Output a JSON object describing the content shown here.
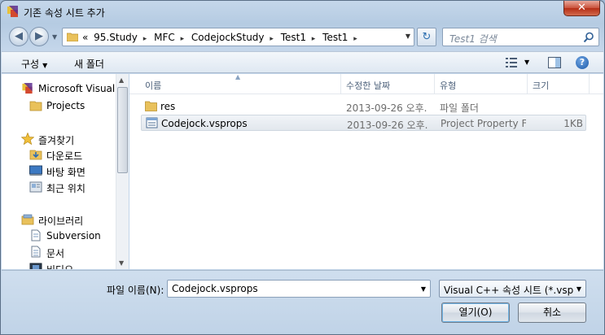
{
  "window": {
    "title": "기존 속성 시트 추가",
    "close_label": "✕"
  },
  "address": {
    "crumbs": [
      "«",
      "95.Study",
      "MFC",
      "CodejockStudy",
      "Test1",
      "Test1"
    ],
    "separator": "▸"
  },
  "search": {
    "placeholder": "Test1 검색"
  },
  "toolbar": {
    "organize_label": "구성",
    "new_folder_label": "새 폴더"
  },
  "nav": {
    "items": [
      {
        "label": "Microsoft Visual S",
        "icon": "visual-studio-icon"
      },
      {
        "label": "Projects",
        "icon": "folder-icon"
      },
      {
        "label": "즐겨찾기",
        "icon": "favorites-star-icon"
      },
      {
        "label": "다운로드",
        "icon": "downloads-icon"
      },
      {
        "label": "바탕 화면",
        "icon": "desktop-icon"
      },
      {
        "label": "최근 위치",
        "icon": "recent-places-icon"
      },
      {
        "label": "라이브러리",
        "icon": "libraries-icon"
      },
      {
        "label": "Subversion",
        "icon": "document-library-icon"
      },
      {
        "label": "문서",
        "icon": "documents-icon"
      },
      {
        "label": "비디오",
        "icon": "videos-icon"
      }
    ]
  },
  "columns": {
    "name": "이름",
    "modified": "수정한 날짜",
    "type": "유형",
    "size": "크기"
  },
  "files": [
    {
      "name": "res",
      "modified": "2013-09-26 오후...",
      "type": "파일 폴더",
      "size": "",
      "icon": "folder-icon"
    },
    {
      "name": "Codejock.vsprops",
      "modified": "2013-09-26 오후...",
      "type": "Project Property F...",
      "size": "1KB",
      "icon": "vsprops-file-icon"
    }
  ],
  "filename": {
    "label": "파일 이름(N):",
    "value": "Codejock.vsprops"
  },
  "filetype": {
    "value": "Visual C++ 속성 시트 (*.vsprops)"
  },
  "buttons": {
    "open_label": "열기(O)",
    "cancel_label": "취소"
  }
}
